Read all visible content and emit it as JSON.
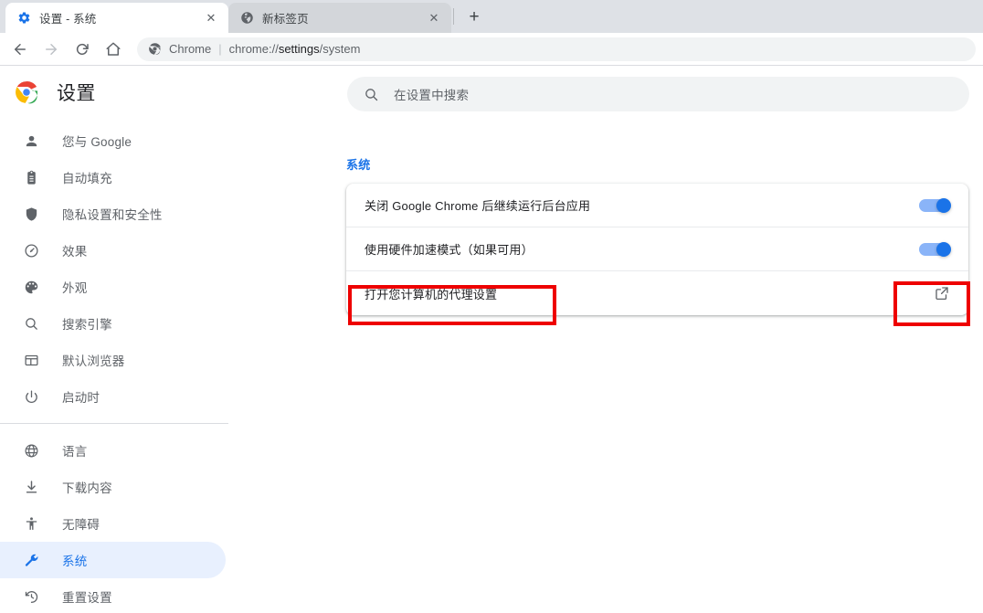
{
  "browser": {
    "tabs": [
      {
        "title": "设置 - 系统",
        "icon": "gear-icon",
        "active": true,
        "close_label": "✕"
      },
      {
        "title": "新标签页",
        "icon": "globe-icon",
        "active": false,
        "close_label": "✕"
      }
    ],
    "new_tab_label": "+",
    "nav": {
      "back_label": "←",
      "forward_label": "→",
      "reload_label": "⟳",
      "home_label": "⌂"
    },
    "omnibox": {
      "scheme_label": "Chrome",
      "separator": "|",
      "url_prefix": "chrome://",
      "url_strong": "settings",
      "url_suffix": "/system"
    }
  },
  "sidebar": {
    "brand": "设置",
    "items": [
      {
        "label": "您与 Google",
        "icon": "person-icon"
      },
      {
        "label": "自动填充",
        "icon": "clipboard-icon"
      },
      {
        "label": "隐私设置和安全性",
        "icon": "shield-icon"
      },
      {
        "label": "效果",
        "icon": "speedometer-icon"
      },
      {
        "label": "外观",
        "icon": "palette-icon"
      },
      {
        "label": "搜索引擎",
        "icon": "search-icon"
      },
      {
        "label": "默认浏览器",
        "icon": "browser-window-icon"
      },
      {
        "label": "启动时",
        "icon": "power-icon"
      }
    ],
    "items_group2": [
      {
        "label": "语言",
        "icon": "globe-icon"
      },
      {
        "label": "下载内容",
        "icon": "download-icon"
      },
      {
        "label": "无障碍",
        "icon": "accessibility-icon"
      },
      {
        "label": "系统",
        "icon": "wrench-icon",
        "selected": true
      },
      {
        "label": "重置设置",
        "icon": "restore-icon"
      }
    ]
  },
  "main": {
    "search": {
      "placeholder": "在设置中搜索",
      "icon": "search-icon"
    },
    "section_title": "系统",
    "rows": [
      {
        "label": "关闭 Google Chrome 后继续运行后台应用",
        "control": "toggle",
        "state": "on"
      },
      {
        "label": "使用硬件加速模式（如果可用）",
        "control": "toggle",
        "state": "on",
        "highlighted": true
      },
      {
        "label": "打开您计算机的代理设置",
        "control": "external-link"
      }
    ]
  },
  "annotations": {
    "color": "#ee0000",
    "boxes": [
      {
        "name": "hardware-acceleration-label-highlight"
      },
      {
        "name": "hardware-acceleration-toggle-highlight"
      }
    ]
  },
  "colors": {
    "accent": "#1a73e8",
    "toggle_track": "#8ab4f8",
    "selected_bg": "#e8f0fe",
    "tab_strip": "#dee1e6",
    "inactive_tab": "#d3d6da",
    "annotation_red": "#ee0000"
  }
}
